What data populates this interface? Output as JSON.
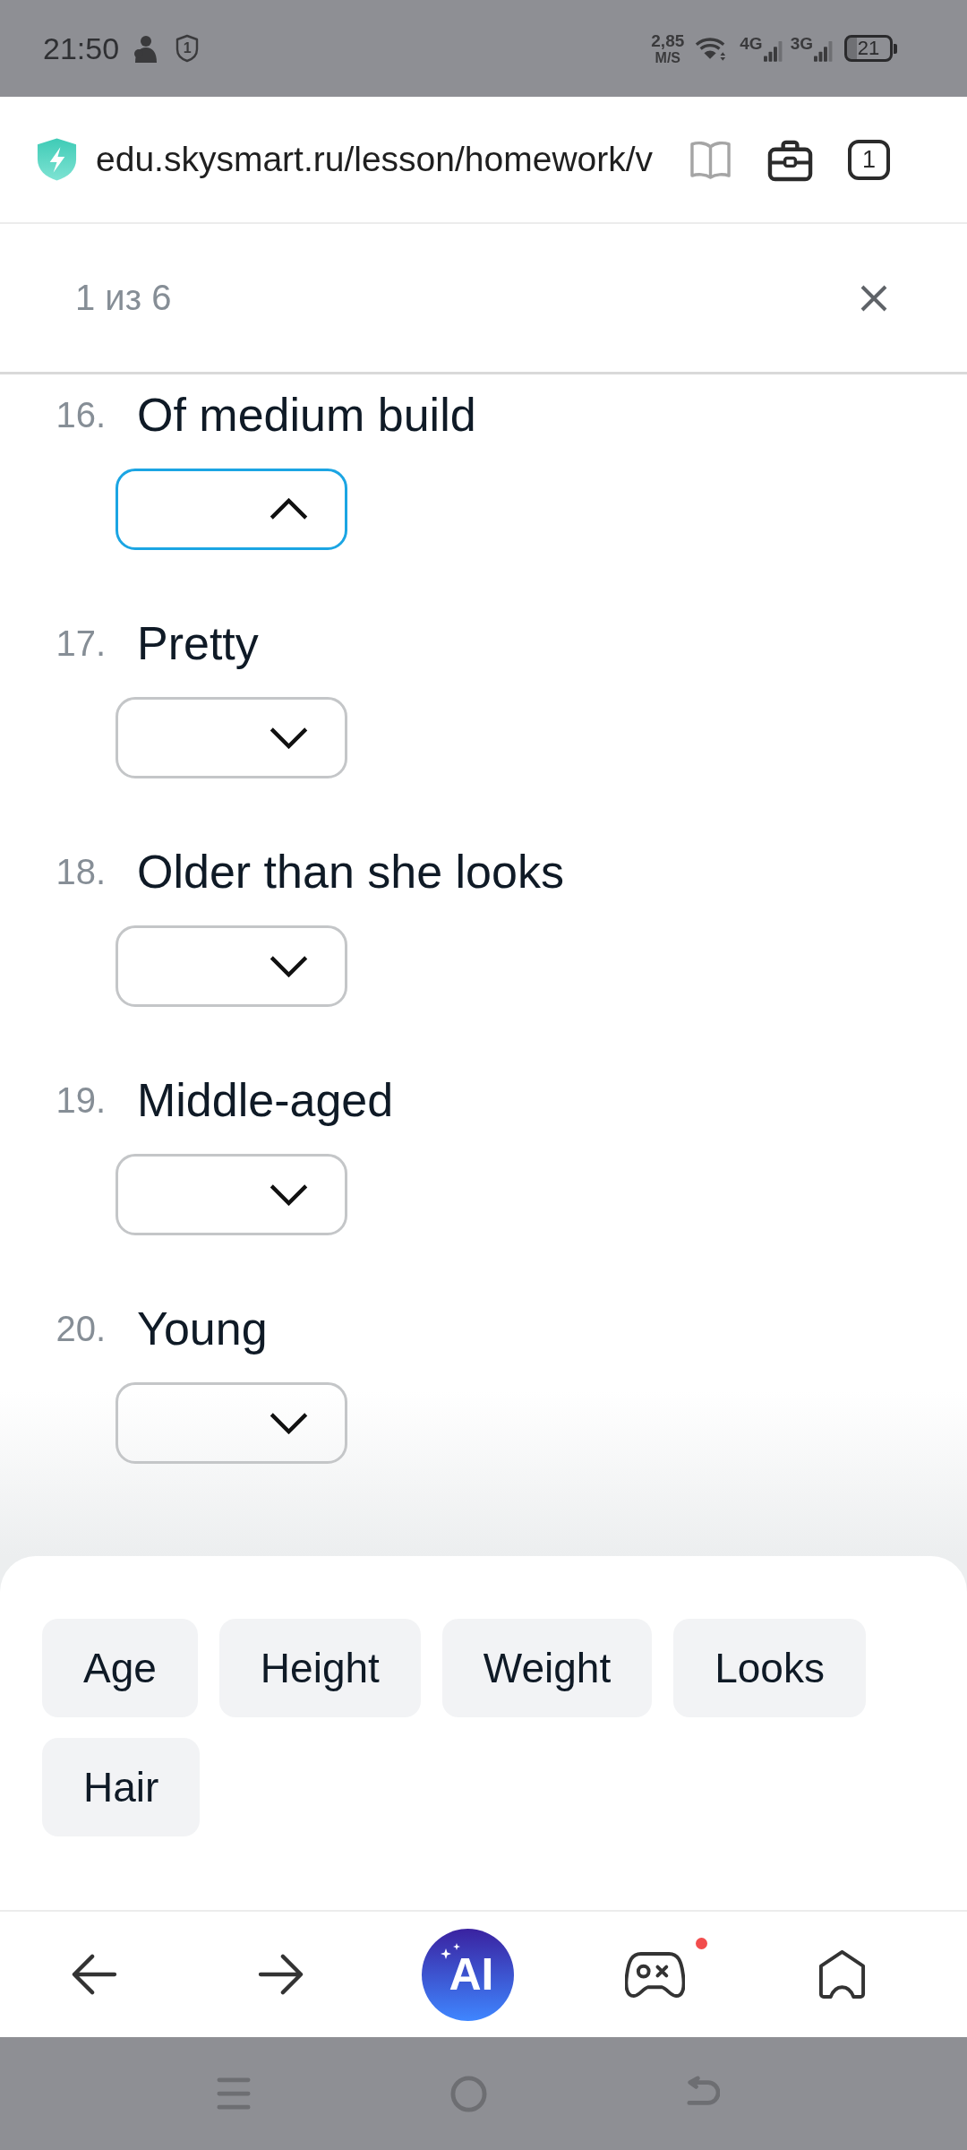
{
  "status_bar": {
    "time": "21:50",
    "shield_badge": "1",
    "network_speed": "2,85",
    "speed_unit": "M/S",
    "networks": [
      "4G",
      "3G"
    ],
    "battery": "21"
  },
  "browser_bar": {
    "url": "edu.skysmart.ru/lesson/homework/v",
    "tab_count": "1"
  },
  "task_header": {
    "progress": "1 из 6"
  },
  "questions": [
    {
      "number": "16.",
      "text": "Of medium build",
      "expanded": true
    },
    {
      "number": "17.",
      "text": "Pretty",
      "expanded": false
    },
    {
      "number": "18.",
      "text": "Older than she looks",
      "expanded": false
    },
    {
      "number": "19.",
      "text": "Middle-aged",
      "expanded": false
    },
    {
      "number": "20.",
      "text": "Young",
      "expanded": false
    }
  ],
  "word_bank": [
    "Age",
    "Height",
    "Weight",
    "Looks",
    "Hair"
  ],
  "bottom_nav": {
    "ai_label": "AI",
    "games_notification": true
  }
}
